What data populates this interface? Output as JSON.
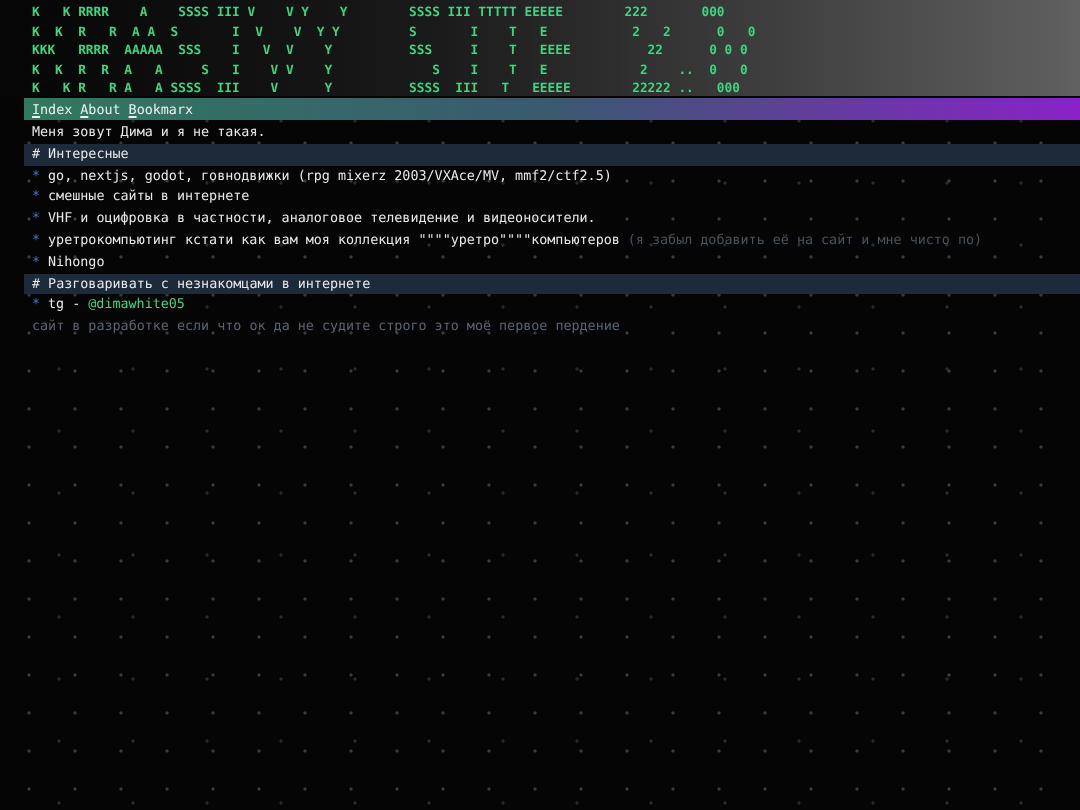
{
  "banner": [
    "K   K RRRR    A    SSSS III V    V Y    Y        SSSS III TTTTT EEEEE        222       000",
    "K  K  R   R  A A  S       I  V    V  Y Y         S       I    T   E           2   2      0   0",
    "KKK   RRRR  AAAAA  SSS    I   V  V    Y          SSS     I    T   EEEE          22      0 0 0",
    "K  K  R  R  A   A     S   I    V V    Y             S    I    T   E            2    ..  0   0",
    "K   K R   R A   A SSSS  III    V      Y          SSSS  III   T   EEEEE        22222 ..   000"
  ],
  "nav": [
    {
      "label": "Index"
    },
    {
      "label": "About"
    },
    {
      "label": "Bookmarx"
    }
  ],
  "blocks": [
    {
      "kind": "text",
      "text": "Меня зовут Дима и я не такая."
    },
    {
      "kind": "heading",
      "text": "# Интересные"
    },
    {
      "kind": "item",
      "bullet": "*",
      "text": "go, nextjs, godot, говнодвижки (rpg mixerz 2003/VXAce/MV, mmf2/ctf2.5)"
    },
    {
      "kind": "item",
      "bullet": "*",
      "text": "смешные сайты в интернете"
    },
    {
      "kind": "item",
      "bullet": "*",
      "text": "VHF и оцифровка в частности, аналоговое телевидение и видеоносители."
    },
    {
      "kind": "item",
      "bullet": "*",
      "text": "уретрокомпьютинг кстати как вам моя коллекция \"\"\"\"уретро\"\"\"\"компьютеров",
      "note": "(я забыл добавить её на сайт и мне чисто по)"
    },
    {
      "kind": "item",
      "bullet": "*",
      "text": "Nihongo"
    },
    {
      "kind": "heading",
      "text": "# Разговаривать с незнакомцами в интернете"
    },
    {
      "kind": "item",
      "bullet": "*",
      "text": "tg -",
      "link": "@dimawhite05"
    },
    {
      "kind": "muted",
      "text": "сайт в разработке если что ок да не судите строго это моё первое пердение"
    }
  ]
}
